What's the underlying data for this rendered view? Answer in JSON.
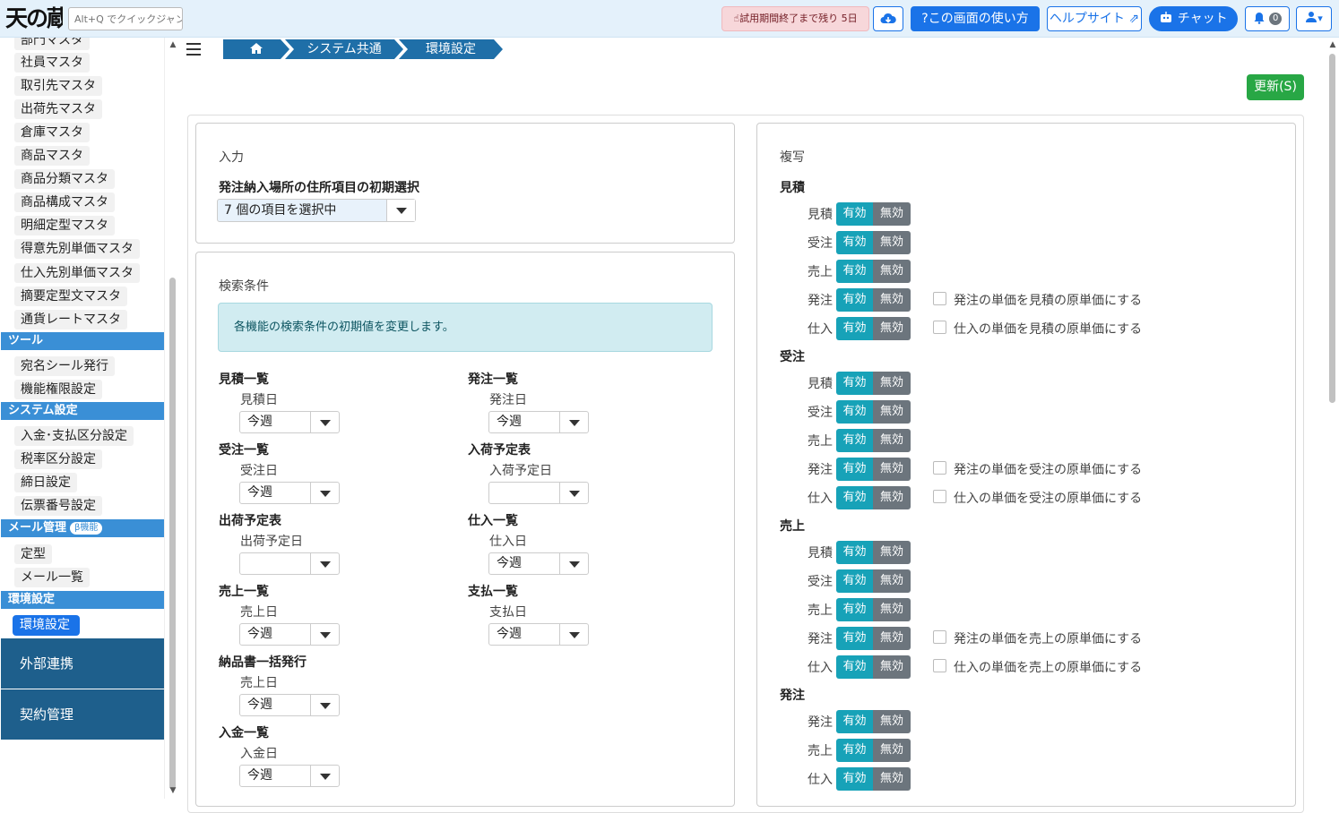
{
  "header": {
    "logo": "天の蔵",
    "jump_placeholder": "Alt+Q でクイックジャンプ",
    "trial_label": "試用期間終了まで残り 5日",
    "help_label": "?この画面の使い方",
    "helpsite_label": "ヘルプサイト",
    "chat_label": "チャット",
    "notif_count": "0"
  },
  "sidebar": {
    "master_items": [
      "部門マスタ",
      "社員マスタ",
      "取引先マスタ",
      "出荷先マスタ",
      "倉庫マスタ",
      "商品マスタ",
      "商品分類マスタ",
      "商品構成マスタ",
      "明細定型マスタ",
      "得意先別単価マスタ",
      "仕入先別単価マスタ",
      "摘要定型文マスタ",
      "通貨レートマスタ"
    ],
    "tools_header": "ツール",
    "tools_items": [
      "宛名シール発行",
      "機能権限設定"
    ],
    "system_header": "システム設定",
    "system_items": [
      "入金･支払区分設定",
      "税率区分設定",
      "締日設定",
      "伝票番号設定"
    ],
    "mail_header": "メール管理",
    "beta_badge": "β機能",
    "mail_items": [
      "定型",
      "メール一覧"
    ],
    "env_header": "環境設定",
    "env_active": "環境設定",
    "external": "外部連携",
    "contract": "契約管理"
  },
  "breadcrumb": [
    "システム共通",
    "環境設定"
  ],
  "update_button": "更新(S)",
  "input_card": {
    "title": "入力",
    "field_label": "発注納入場所の住所項目の初期選択",
    "field_value": "7 個の項目を選択中"
  },
  "search_card": {
    "title": "検索条件",
    "info": "各機能の検索条件の初期値を変更します。",
    "left": [
      {
        "group": "見積一覧",
        "field": "見積日",
        "value": "今週"
      },
      {
        "group": "受注一覧",
        "field": "受注日",
        "value": "今週"
      },
      {
        "group": "出荷予定表",
        "field": "出荷予定日",
        "value": ""
      },
      {
        "group": "売上一覧",
        "field": "売上日",
        "value": "今週"
      },
      {
        "group": "納品書一括発行",
        "field": "売上日",
        "value": "今週"
      },
      {
        "group": "入金一覧",
        "field": "入金日",
        "value": "今週"
      }
    ],
    "right": [
      {
        "group": "発注一覧",
        "field": "発注日",
        "value": "今週"
      },
      {
        "group": "入荷予定表",
        "field": "入荷予定日",
        "value": ""
      },
      {
        "group": "仕入一覧",
        "field": "仕入日",
        "value": "今週"
      },
      {
        "group": "支払一覧",
        "field": "支払日",
        "value": "今週"
      }
    ]
  },
  "copy_card": {
    "title": "複写",
    "on_label": "有効",
    "off_label": "無効",
    "sections": [
      {
        "name": "見積",
        "rows": [
          {
            "label": "見積",
            "check": ""
          },
          {
            "label": "受注",
            "check": ""
          },
          {
            "label": "売上",
            "check": ""
          },
          {
            "label": "発注",
            "check": "発注の単価を見積の原単価にする"
          },
          {
            "label": "仕入",
            "check": "仕入の単価を見積の原単価にする"
          }
        ]
      },
      {
        "name": "受注",
        "rows": [
          {
            "label": "見積",
            "check": ""
          },
          {
            "label": "受注",
            "check": ""
          },
          {
            "label": "売上",
            "check": ""
          },
          {
            "label": "発注",
            "check": "発注の単価を受注の原単価にする"
          },
          {
            "label": "仕入",
            "check": "仕入の単価を受注の原単価にする"
          }
        ]
      },
      {
        "name": "売上",
        "rows": [
          {
            "label": "見積",
            "check": ""
          },
          {
            "label": "受注",
            "check": ""
          },
          {
            "label": "売上",
            "check": ""
          },
          {
            "label": "発注",
            "check": "発注の単価を売上の原単価にする"
          },
          {
            "label": "仕入",
            "check": "仕入の単価を売上の原単価にする"
          }
        ]
      },
      {
        "name": "発注",
        "rows": [
          {
            "label": "発注",
            "check": ""
          },
          {
            "label": "売上",
            "check": ""
          },
          {
            "label": "仕入",
            "check": ""
          }
        ]
      }
    ]
  }
}
